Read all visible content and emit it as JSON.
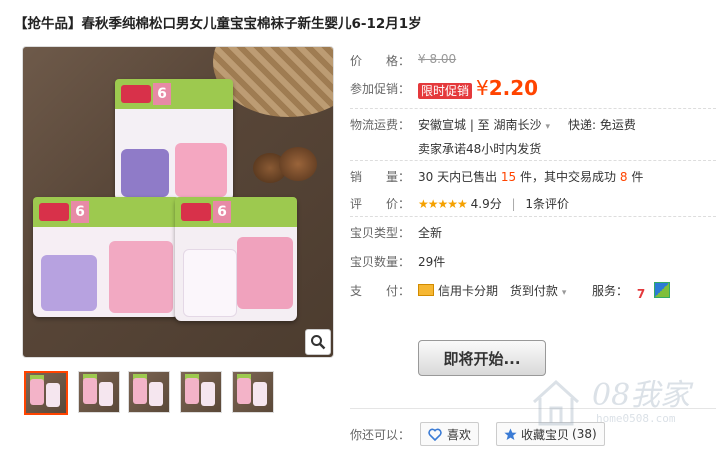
{
  "product": {
    "title": "【抢牛品】春秋季纯棉松口男女儿童宝宝棉袜子新生婴儿6-12月1岁"
  },
  "details": {
    "price_label": "价　　格：",
    "price_value": "¥ 8.00",
    "promo_label": "参加促销：",
    "promo_badge": "限时促销",
    "promo_currency": "¥",
    "promo_price": "2.20",
    "shipping_label": "物流运费：",
    "shipping_route": "安徽宣城 | 至  湖南长沙",
    "shipping_fee": "快递: 免运费",
    "shipping_promise": "卖家承诺48小时内发货",
    "sales_label": "销　　量：",
    "sales_prefix": "30 天内已售出",
    "sales_count": "15",
    "sales_mid": "件，其中交易成功",
    "sales_success": "8",
    "sales_unit": "件",
    "rating_label": "评　　价：",
    "rating_stars": "★★★★★",
    "rating_score": "4.9分",
    "rating_sep": "|",
    "rating_reviews": "1条评价",
    "type_label": "宝贝类型：",
    "type_value": "全新",
    "qty_label": "宝贝数量：",
    "qty_value": "29件",
    "pay_label": "支　　付：",
    "pay_credit": "信用卡分期",
    "pay_cod": "货到付款",
    "service_label": "服务：",
    "service_7_glyph": "7"
  },
  "actions": {
    "coming_soon_label": "即将开始...",
    "share_label": "你还可以：",
    "like_label": "喜欢",
    "favorite_label": "收藏宝贝",
    "favorite_count": "(38)"
  },
  "images": {
    "thumbnail_count": 5,
    "active_thumbnail": 1
  },
  "watermark": {
    "big": "08我家",
    "small": "home0508.com"
  },
  "icons": {
    "zoom": "magnifier-icon",
    "like": "heart-icon",
    "favorite": "star-icon",
    "credit": "credit-card-icon",
    "service_7": "seven-day-return-icon",
    "service_box": "guarantee-icon"
  },
  "colors": {
    "accent": "#f40",
    "badge": "#e4393c",
    "stars": "#f5a100"
  }
}
